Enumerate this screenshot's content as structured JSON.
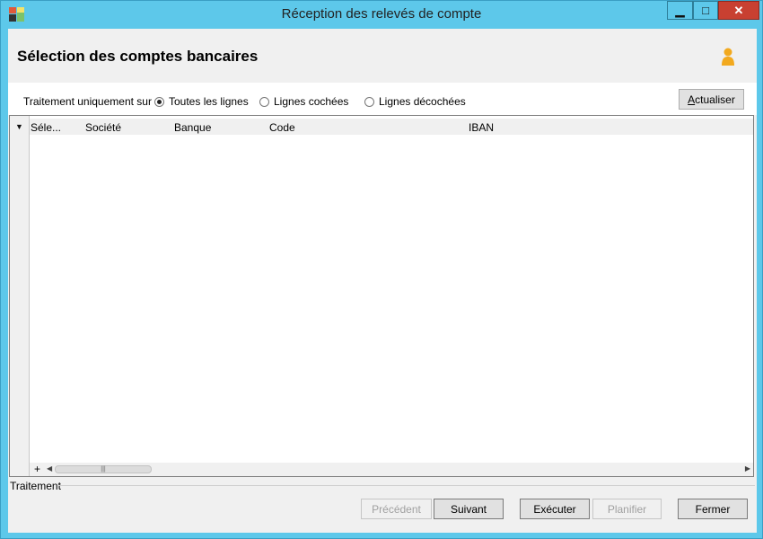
{
  "window": {
    "title": "Réception des relevés de compte",
    "minimize": "▁",
    "maximize": "□",
    "close": "✕"
  },
  "header": {
    "title": "Sélection des comptes bancaires"
  },
  "filter": {
    "label": "Traitement uniquement sur :",
    "options": [
      {
        "label": "Toutes les lignes",
        "selected": true
      },
      {
        "label": "Lignes cochées",
        "selected": false
      },
      {
        "label": "Lignes décochées",
        "selected": false
      }
    ],
    "refresh_label": "Actualiser"
  },
  "grid": {
    "columns": [
      "Séle...",
      "Société",
      "Banque",
      "Code",
      "IBAN"
    ],
    "rows": [],
    "add_symbol": "+",
    "scroll_left": "◀",
    "scroll_right": "▶",
    "thumb_grip": "|||"
  },
  "footer": {
    "section_label": "Traitement",
    "buttons": {
      "previous": "Précédent",
      "next": "Suivant",
      "execute": "Exécuter",
      "schedule": "Planifier",
      "close": "Fermer"
    }
  },
  "colors": {
    "title_bar": "#5dc8ea",
    "close_button": "#c84031",
    "client_bg": "#f0f0f0"
  }
}
